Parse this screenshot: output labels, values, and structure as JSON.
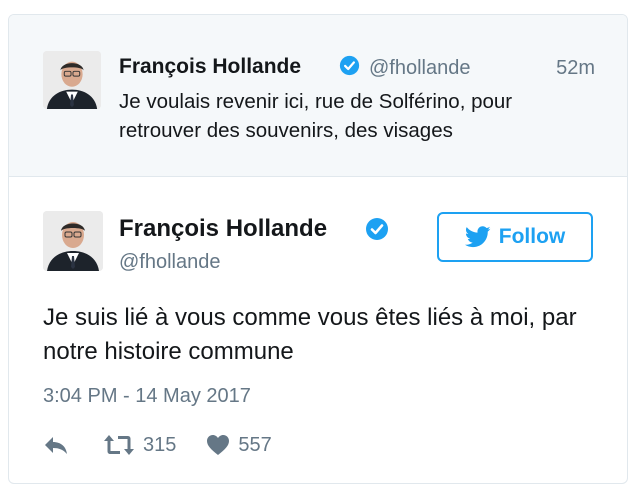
{
  "quoted_tweet": {
    "author_name": "François Hollande",
    "handle": "@fhollande",
    "time": "52m",
    "text": "Je voulais revenir ici, rue de Solférino, pour retrouver des souvenirs, des visages"
  },
  "main_tweet": {
    "author_name": "François Hollande",
    "handle": "@fhollande",
    "follow_label": "Follow",
    "text": "Je suis lié à vous comme vous êtes liés à moi, par notre histoire commune",
    "timestamp": "3:04 PM - 14 May 2017",
    "retweets": "315",
    "likes": "557"
  },
  "colors": {
    "accent": "#1da1f2",
    "muted": "#657786",
    "text": "#14171a",
    "parent_bg": "#f5f8fa",
    "border": "#e1e8ed"
  },
  "icons": [
    "verified-badge-icon",
    "twitter-bird-icon",
    "reply-icon",
    "retweet-icon",
    "heart-icon"
  ]
}
